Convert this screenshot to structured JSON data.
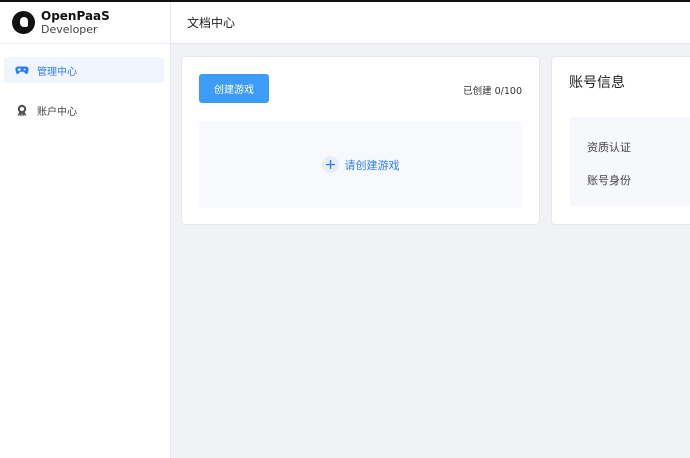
{
  "brand": {
    "title": "OpenPaaS",
    "subtitle": "Developer"
  },
  "header": {
    "title": "文档中心"
  },
  "sidebar": {
    "items": [
      {
        "label": "管理中心",
        "icon": "gamepad-icon",
        "active": true
      },
      {
        "label": "账户中心",
        "icon": "badge-icon",
        "active": false
      }
    ]
  },
  "games": {
    "create_label": "创建游戏",
    "created_count": "已创建 0/100",
    "empty_label": "请创建游戏"
  },
  "account": {
    "title": "账号信息",
    "rows": [
      {
        "label": "资质认证"
      },
      {
        "label": "账号身份"
      }
    ]
  },
  "colors": {
    "accent": "#2d7ff9",
    "button": "#3d9cf7",
    "background": "#f1f2f6"
  }
}
